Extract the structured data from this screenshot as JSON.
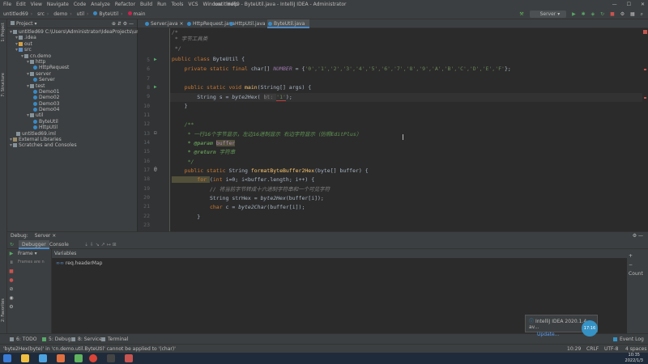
{
  "window": {
    "title": "untitled69 - ByteUtil.java - IntelliJ IDEA - Administrator",
    "menu": [
      "File",
      "Edit",
      "View",
      "Navigate",
      "Code",
      "Analyze",
      "Refactor",
      "Build",
      "Run",
      "Tools",
      "VCS",
      "Window",
      "Help"
    ],
    "controls": [
      "—",
      "☐",
      "✕"
    ]
  },
  "breadcrumb": [
    "untitled69",
    "src",
    "demo",
    "util",
    "ByteUtil",
    "main"
  ],
  "run_config": "Server",
  "project_panel": {
    "title": "Project",
    "root": "untitled69",
    "root_path": "C:\\Users\\Administrator\\IdeaProjects\\untitled69",
    "items": [
      {
        "label": "untitled69  C:\\Users\\Administrator\\IdeaProjects\\untitled69",
        "indent": 0,
        "icon": "folder-icon"
      },
      {
        "label": ".idea",
        "indent": 1,
        "icon": "folder-icon"
      },
      {
        "label": "out",
        "indent": 1,
        "icon": "folder-orange-icon"
      },
      {
        "label": "src",
        "indent": 1,
        "icon": "folder-blue-icon"
      },
      {
        "label": "cn.demo",
        "indent": 2,
        "icon": "package-icon"
      },
      {
        "label": "http",
        "indent": 3,
        "icon": "package-icon"
      },
      {
        "label": "HttpRequest",
        "indent": 4,
        "icon": "class-icon"
      },
      {
        "label": "server",
        "indent": 3,
        "icon": "package-icon"
      },
      {
        "label": "Server",
        "indent": 4,
        "icon": "class-icon"
      },
      {
        "label": "test",
        "indent": 3,
        "icon": "package-icon"
      },
      {
        "label": "Demo01",
        "indent": 4,
        "icon": "class-icon"
      },
      {
        "label": "Demo02",
        "indent": 4,
        "icon": "class-icon"
      },
      {
        "label": "Demo03",
        "indent": 4,
        "icon": "class-icon"
      },
      {
        "label": "Demo04",
        "indent": 4,
        "icon": "class-icon"
      },
      {
        "label": "util",
        "indent": 3,
        "icon": "package-icon"
      },
      {
        "label": "ByteUtil",
        "indent": 4,
        "icon": "class-icon"
      },
      {
        "label": "HttpUtil",
        "indent": 4,
        "icon": "class-icon"
      },
      {
        "label": "untitled69.iml",
        "indent": 1,
        "icon": "file-icon"
      },
      {
        "label": "External Libraries",
        "indent": 0,
        "icon": "library-icon"
      },
      {
        "label": "Scratches and Consoles",
        "indent": 0,
        "icon": "scratch-icon"
      }
    ]
  },
  "left_strip": [
    "1: Project",
    "7: Structure",
    "2: Favorites"
  ],
  "tabs": [
    {
      "label": "Server.java",
      "active": false
    },
    {
      "label": "HttpRequest.java",
      "active": false
    },
    {
      "label": "HttpUtil.java",
      "active": false
    },
    {
      "label": "ByteUtil.java",
      "active": true
    }
  ],
  "editor": {
    "line_numbers": [
      "",
      "",
      "",
      "5",
      "6",
      "7",
      "8",
      "9",
      "10",
      "11",
      "12",
      "13",
      "14",
      "15",
      "16",
      "17",
      "18",
      "19",
      "20",
      "21",
      "22",
      "23",
      "24"
    ],
    "lines": {
      "l1": "/*",
      "l2_star": " * ",
      "l2_text": "字节工具类",
      "l3": " */",
      "l5_kw": "public class ",
      "l5_name": "ByteUtil {",
      "l6_kw": "    private static final ",
      "l6_type": "char[] ",
      "l6_const": "NUMBER",
      "l6_eq": " = {",
      "l6_vals": "'0','1','2','3','4','5','6','7','8','9','A','B','C','D','E','F'",
      "l6_end": "};",
      "l8_kw": "    public static void ",
      "l8_fn": "main",
      "l8_rest": "(String[] args) {",
      "l9_a": "        String s = ",
      "l9_fn": "byte2Hex",
      "l9_p": "( ",
      "l9_hint": "bt: ",
      "l9_str": "'1'",
      "l9_end": ");",
      "l10": "    }",
      "l12": "    /**",
      "l13": "     * 一行16个字节显示，左边16进制显示 右边字符显示（仿照EditPlus）",
      "l14_tag": "     * @param ",
      "l14_param": "buffer",
      "l15_tag": "     * @return ",
      "l15_text": "字符串",
      "l16": "     */",
      "l17_kw": "    public static ",
      "l17_type": "String ",
      "l17_fn": "formatByteBuffer2Hex",
      "l17_rest": "(byte[] buffer) {",
      "l18_kw": "        for ",
      "l18_a": "(",
      "l18_kw2": "int ",
      "l18_rest": "i=0; i<buffer.length; i++) {",
      "l19": "            // 将当前字节转成十六进制字符串和一个可见字符",
      "l20_a": "            String strHex = ",
      "l20_fn": "byte2Hex",
      "l20_rest": "(buffer[i]);",
      "l21_kw": "            char ",
      "l21_a": "c = ",
      "l21_fn": "byte2Char",
      "l21_rest": "(buffer[i]);",
      "l22": "        }"
    }
  },
  "debug_panel": {
    "title_debug": "Debug:",
    "title_config": "Server",
    "tab_debugger": "Debugger",
    "tab_console": "Console",
    "frames_label": "Frame",
    "variables_label": "Variables",
    "frames_empty": "Frames are n",
    "variable": "req.headerMap",
    "count_label": "Count"
  },
  "bottom_tabs": [
    "6: TODO",
    "5: Debug",
    "8: Services",
    "Terminal"
  ],
  "event_log": "Event Log",
  "status": {
    "message": "'byte2Hex(byte)' in 'cn.demo.util.ByteUtil' cannot be applied to '(char)'",
    "position": "10:29",
    "line_sep": "CRLF",
    "encoding": "UTF-8",
    "indent": "4 spaces"
  },
  "notification": {
    "title": "IntelliJ IDEA 2020.1.4 av...",
    "link": "Update...",
    "bubble": "17:16"
  },
  "clock": {
    "time": "10:35",
    "date": "2022/1/3"
  }
}
